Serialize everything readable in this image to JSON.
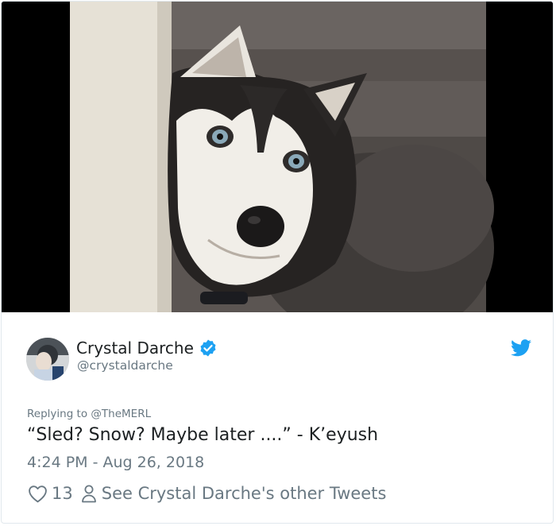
{
  "tweet": {
    "author_name": "Crystal Darche",
    "author_handle": "@crystaldarche",
    "reply_prefix": "Replying to",
    "reply_to": "@TheMERL",
    "text": "“Sled? Snow? Maybe later ....” - K’eyush",
    "timestamp": "4:24 PM - Aug 26, 2018",
    "like_count": "13",
    "profile_link_label": "See Crystal Darche's other Tweets"
  },
  "icons": {
    "verified": "verified-badge-icon",
    "brand": "twitter-bird-icon",
    "like": "heart-outline-icon",
    "profile": "person-outline-icon"
  },
  "colors": {
    "brand_blue": "#1da1f2",
    "text_primary": "#1c2022",
    "text_secondary": "#697882",
    "border": "#e1e8ed"
  }
}
